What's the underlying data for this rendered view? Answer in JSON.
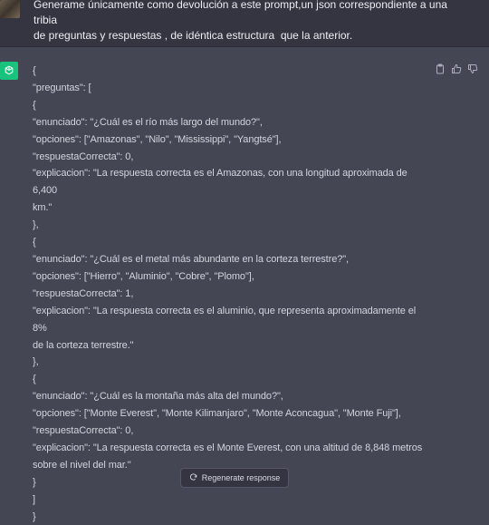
{
  "user_message": {
    "text": "Generame únicamente como devolución a este prompt,un json correspondiente a una  tribia\nde preguntas y respuestas , de idéntica estructura  que la anterior."
  },
  "assistant_message": {
    "lines": [
      "{",
      "\"preguntas\": [",
      "{",
      "\"enunciado\": \"¿Cuál es el río más largo del mundo?\",",
      "\"opciones\": [\"Amazonas\", \"Nilo\", \"Mississippi\", \"Yangtsé\"],",
      "\"respuestaCorrecta\": 0,",
      "\"explicacion\": \"La respuesta correcta es el Amazonas, con una longitud aproximada de 6,400",
      "km.\"",
      "},",
      "{",
      "\"enunciado\": \"¿Cuál es el metal más abundante en la corteza terrestre?\",",
      "\"opciones\": [\"Hierro\", \"Aluminio\", \"Cobre\", \"Plomo\"],",
      "\"respuestaCorrecta\": 1,",
      "\"explicacion\": \"La respuesta correcta es el aluminio, que representa aproximadamente el 8%",
      "de la corteza terrestre.\"",
      "},",
      "{",
      "\"enunciado\": \"¿Cuál es la montaña más alta del mundo?\",",
      "\"opciones\": [\"Monte Everest\", \"Monte Kilimanjaro\", \"Monte Aconcagua\", \"Monte Fuji\"],",
      "\"respuestaCorrecta\": 0,",
      "\"explicacion\": \"La respuesta correcta es el Monte Everest, con una altitud de 8,848 metros",
      "sobre el nivel del mar.\"",
      "}",
      "]",
      "}"
    ]
  },
  "actions": {
    "icons": [
      "clipboard-icon",
      "thumbs-up-icon",
      "thumbs-down-icon"
    ]
  },
  "regenerate": {
    "label": "Regenerate response",
    "icon": "refresh-icon"
  },
  "colors": {
    "user_bg": "#343541",
    "assistant_bg": "#444654",
    "gpt_avatar": "#19c37d",
    "text": "#d1d5db"
  }
}
